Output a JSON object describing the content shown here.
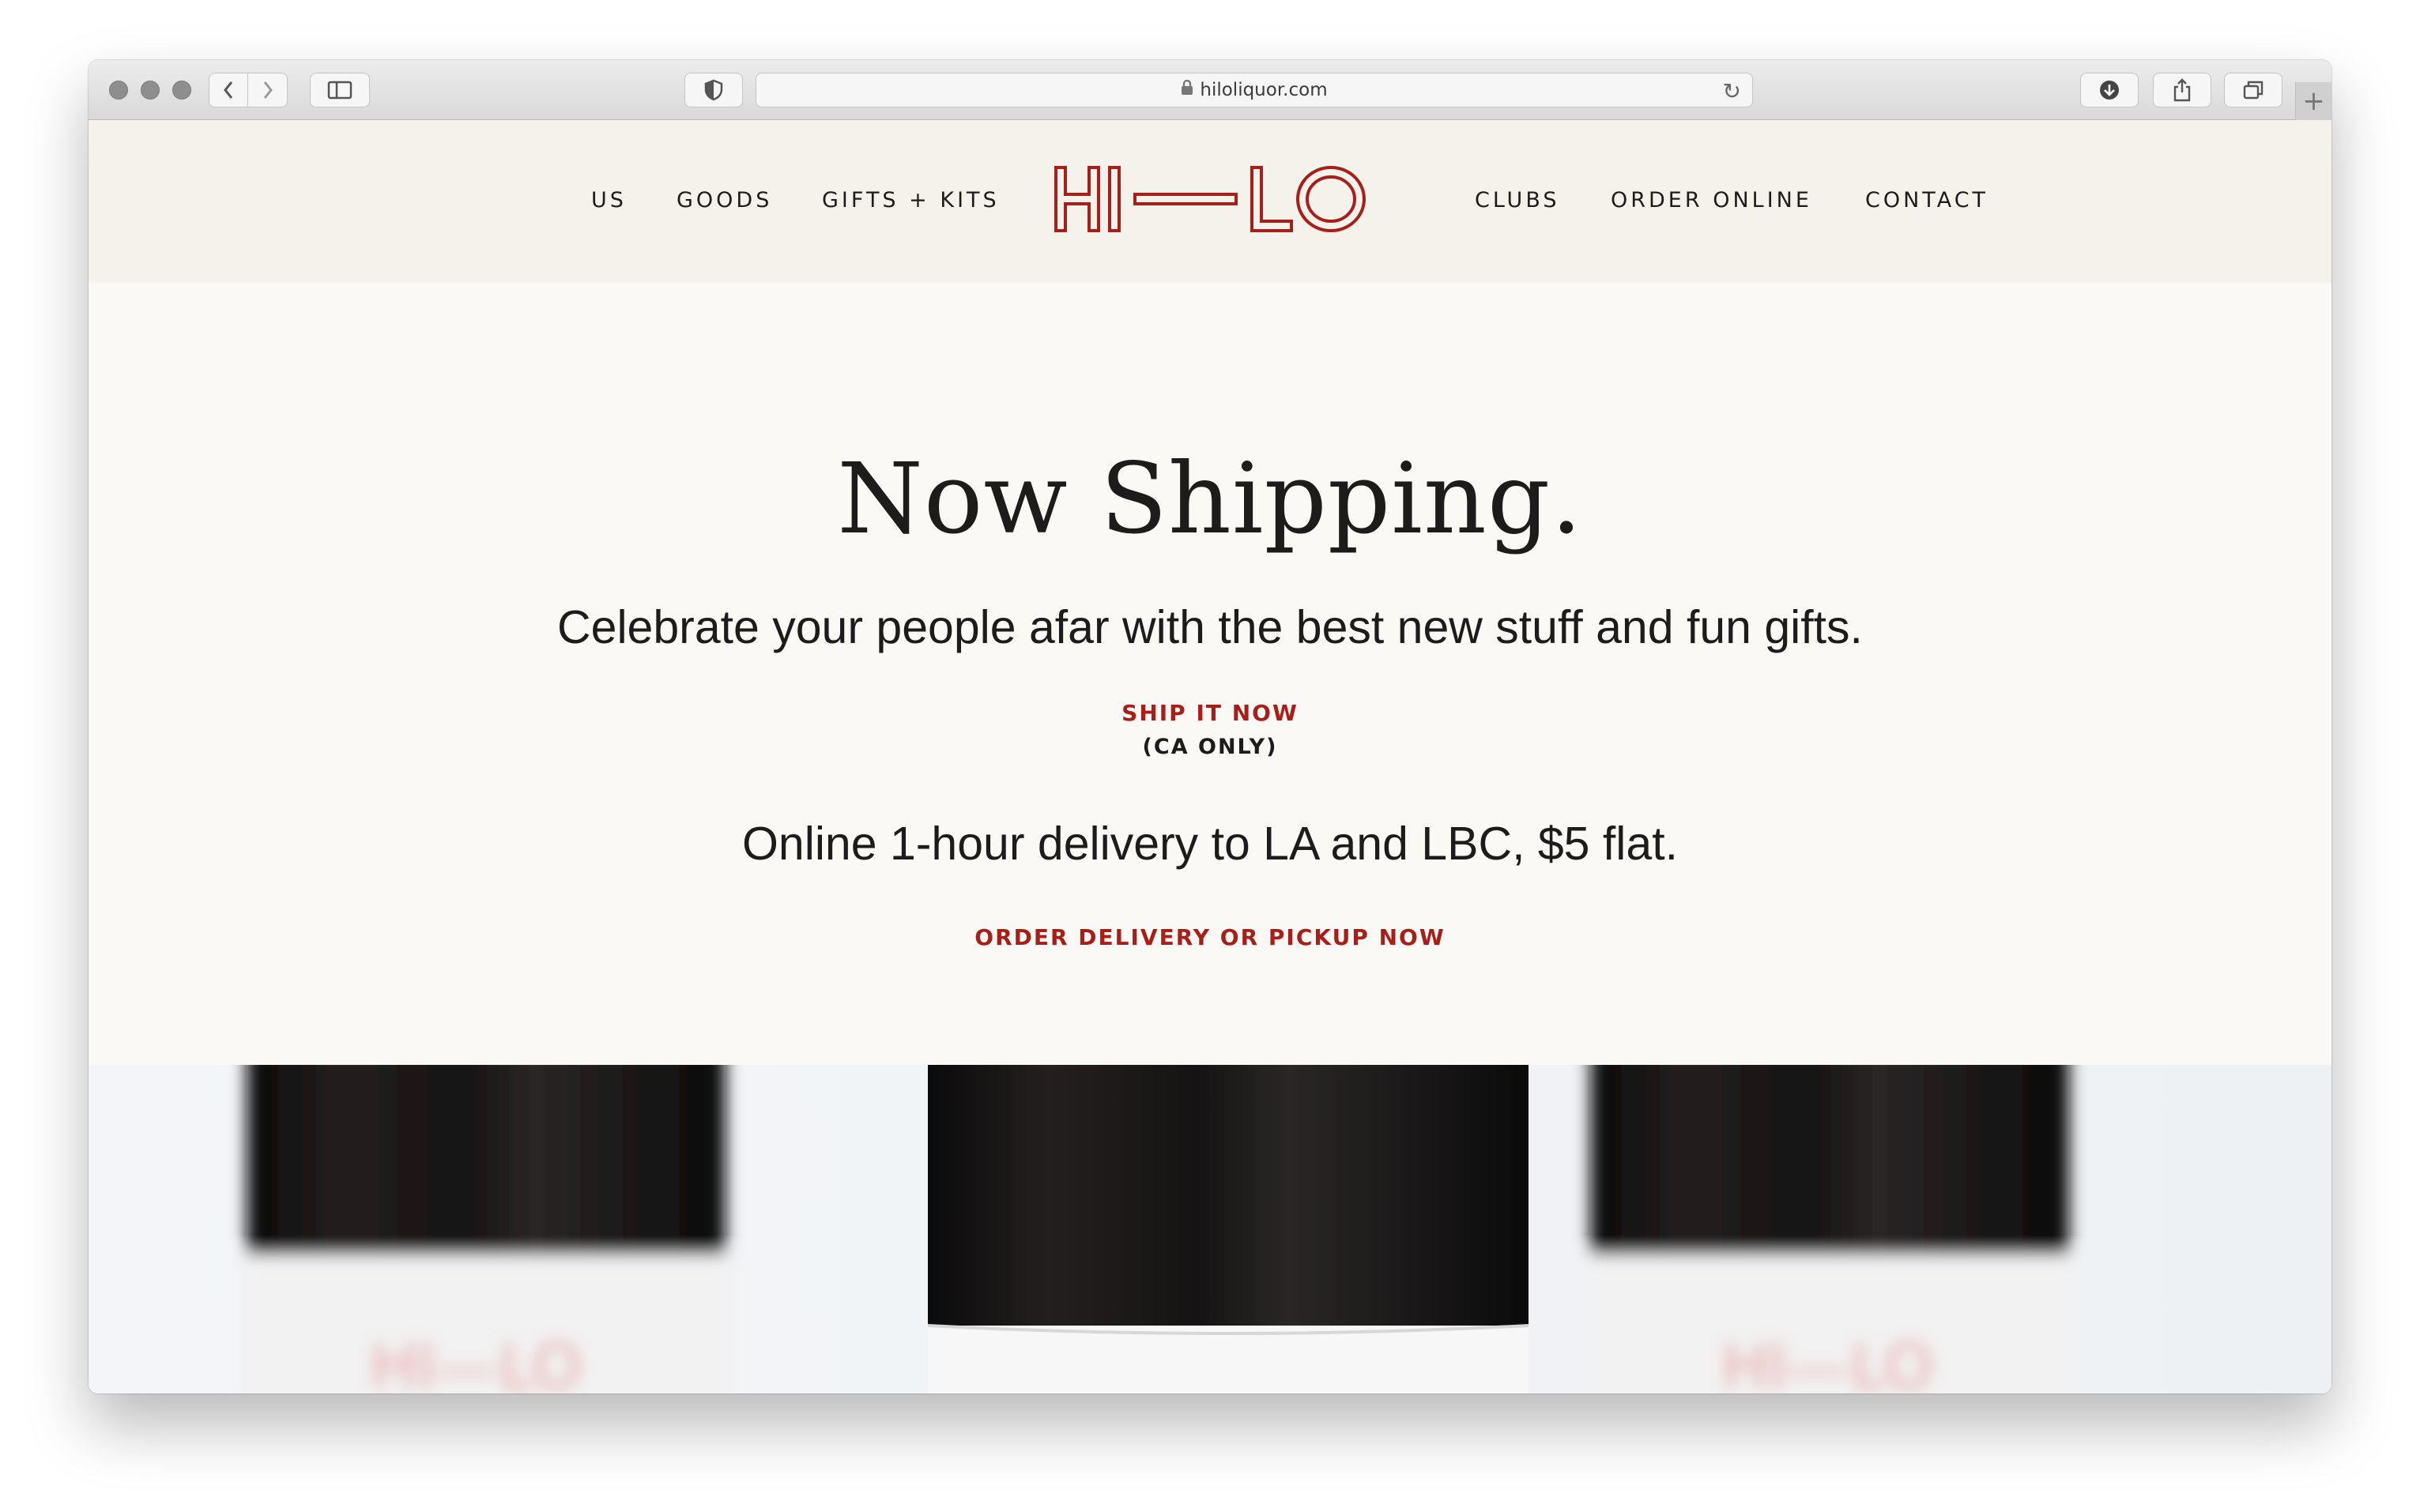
{
  "browser": {
    "url": "hiloliquor.com"
  },
  "nav": {
    "left": [
      "US",
      "GOODS",
      "GIFTS + KITS"
    ],
    "right": [
      "CLUBS",
      "ORDER ONLINE",
      "CONTACT"
    ],
    "logo_text": "HI—LO"
  },
  "hero": {
    "headline": "Now Shipping.",
    "subheadline": "Celebrate your people afar with the best new stuff and fun gifts.",
    "ship_link": "SHIP IT NOW",
    "ship_note": "(CA ONLY)",
    "delivery_text": "Online 1-hour delivery to LA and LBC, $5 flat.",
    "order_link": "ORDER DELIVERY OR PICKUP NOW"
  },
  "colors": {
    "brand_red": "#a81f1a",
    "header_bg": "#f5f1eb",
    "hero_bg": "#faf9f6",
    "text": "#1d1b1b"
  }
}
